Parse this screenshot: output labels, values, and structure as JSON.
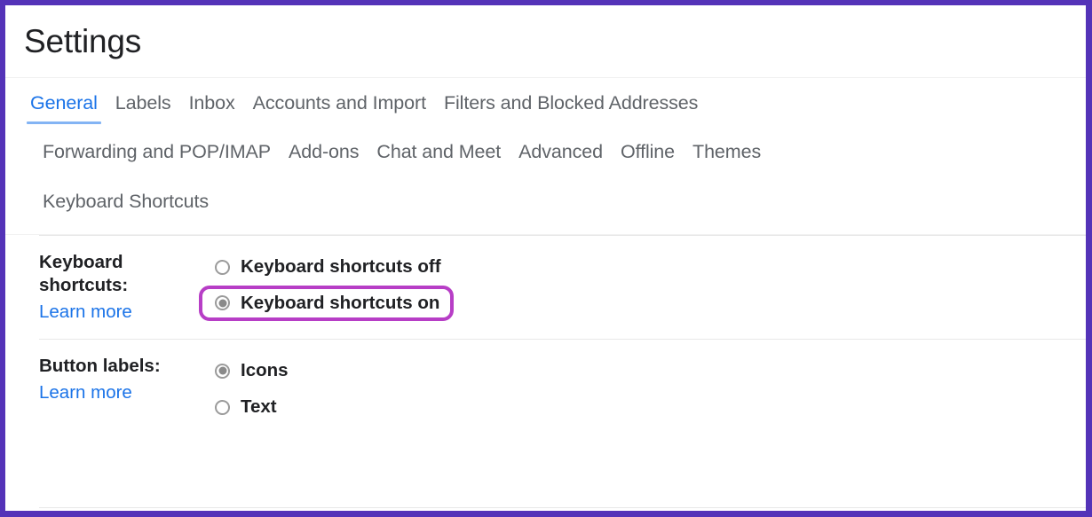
{
  "annotation": {
    "frame_color": "#5433b8",
    "highlight_color": "#b73ec6"
  },
  "header": {
    "title": "Settings"
  },
  "colors": {
    "accent_blue": "#1a73e8",
    "tab_inactive": "#5f6368",
    "text_primary": "#202124",
    "divider": "#e8e8e8"
  },
  "tabs": {
    "rows": [
      [
        {
          "label": "General",
          "active": true
        },
        {
          "label": "Labels",
          "active": false
        },
        {
          "label": "Inbox",
          "active": false
        },
        {
          "label": "Accounts and Import",
          "active": false
        },
        {
          "label": "Filters and Blocked Addresses",
          "active": false
        }
      ],
      [
        {
          "label": "Forwarding and POP/IMAP",
          "active": false
        },
        {
          "label": "Add-ons",
          "active": false
        },
        {
          "label": "Chat and Meet",
          "active": false
        },
        {
          "label": "Advanced",
          "active": false
        },
        {
          "label": "Offline",
          "active": false
        },
        {
          "label": "Themes",
          "active": false
        }
      ],
      [
        {
          "label": "Keyboard Shortcuts",
          "active": false
        }
      ]
    ]
  },
  "settings": [
    {
      "id": "keyboard-shortcuts",
      "label": "Keyboard shortcuts:",
      "learn_more": "Learn more",
      "options": [
        {
          "label": "Keyboard shortcuts off",
          "checked": false,
          "highlighted": false
        },
        {
          "label": "Keyboard shortcuts on",
          "checked": true,
          "highlighted": true
        }
      ]
    },
    {
      "id": "button-labels",
      "label": "Button labels:",
      "learn_more": "Learn more",
      "options": [
        {
          "label": "Icons",
          "checked": true,
          "highlighted": false
        },
        {
          "label": "Text",
          "checked": false,
          "highlighted": false
        }
      ]
    }
  ]
}
